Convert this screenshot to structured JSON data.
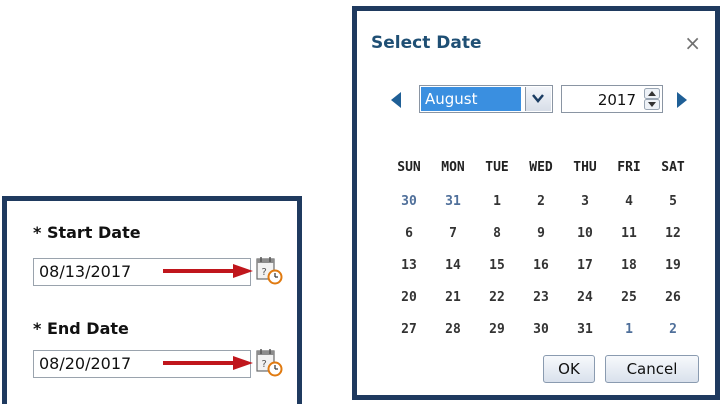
{
  "form": {
    "start_label": "* Start Date",
    "start_value": "08/13/2017",
    "end_label": "* End Date",
    "end_value": "08/20/2017"
  },
  "icons": {
    "calendar": "calendar-clock-icon",
    "arrow": "red-arrow-icon"
  },
  "colors": {
    "panel_border": "#1f3a5f",
    "arrow": "#c0161c",
    "title": "#1f4f74",
    "month_highlight": "#3a8fe0"
  },
  "dialog": {
    "title": "Select Date",
    "close_glyph": "×",
    "month": "August",
    "year": "2017",
    "days_of_week": [
      "SUN",
      "MON",
      "TUE",
      "WED",
      "THU",
      "FRI",
      "SAT"
    ],
    "weeks": [
      [
        {
          "d": "30",
          "other": true
        },
        {
          "d": "31",
          "other": true
        },
        {
          "d": "1",
          "today": true
        },
        {
          "d": "2"
        },
        {
          "d": "3"
        },
        {
          "d": "4"
        },
        {
          "d": "5"
        }
      ],
      [
        {
          "d": "6"
        },
        {
          "d": "7"
        },
        {
          "d": "8"
        },
        {
          "d": "9"
        },
        {
          "d": "10"
        },
        {
          "d": "11"
        },
        {
          "d": "12"
        }
      ],
      [
        {
          "d": "13"
        },
        {
          "d": "14"
        },
        {
          "d": "15"
        },
        {
          "d": "16"
        },
        {
          "d": "17"
        },
        {
          "d": "18"
        },
        {
          "d": "19"
        }
      ],
      [
        {
          "d": "20"
        },
        {
          "d": "21"
        },
        {
          "d": "22"
        },
        {
          "d": "23"
        },
        {
          "d": "24"
        },
        {
          "d": "25",
          "selected": true
        },
        {
          "d": "26"
        }
      ],
      [
        {
          "d": "27"
        },
        {
          "d": "28"
        },
        {
          "d": "29"
        },
        {
          "d": "30"
        },
        {
          "d": "31"
        },
        {
          "d": "1",
          "other": true
        },
        {
          "d": "2",
          "other": true
        }
      ]
    ],
    "ok_label": "OK",
    "cancel_label": "Cancel"
  }
}
